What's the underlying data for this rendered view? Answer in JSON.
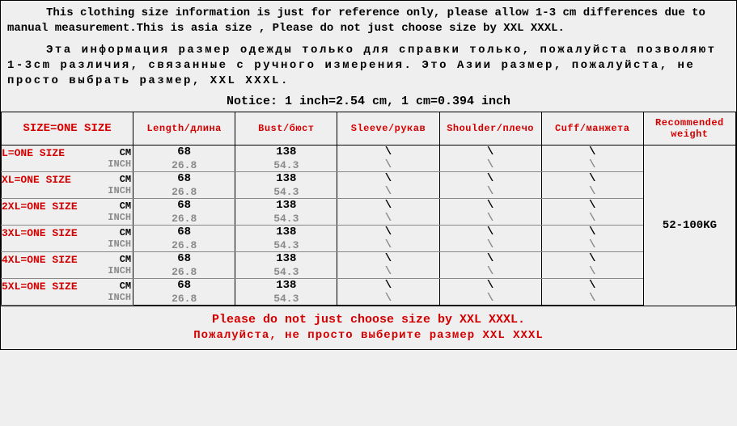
{
  "info_en": "This clothing size information is just for reference only, please allow 1-3 cm differences due to manual measurement.This is asia size , Please do not just choose size by XXL XXXL.",
  "info_ru": "Эта информация размер одежды только для справки только, пожалуйста позволяют 1-3cm различия, связанные с ручного измерения. Это Азии размер, пожалуйста, не просто выбрать размер, XXL XXXL.",
  "notice": "Notice: 1 inch=2.54 cm, 1 cm=0.394 inch",
  "headers": {
    "size": "SIZE=ONE SIZE",
    "length": "Length/длина",
    "bust": "Bust/бюст",
    "sleeve": "Sleeve/рукав",
    "shoulder": "Shoulder/плечо",
    "cuff": "Cuff/манжета",
    "weight": "Recommended weight"
  },
  "units": {
    "cm": "CM",
    "inch": "INCH"
  },
  "rows": [
    {
      "size": "L=ONE SIZE",
      "length_cm": "68",
      "length_in": "26.8",
      "bust_cm": "138",
      "bust_in": "54.3",
      "sleeve": "\\",
      "shoulder": "\\",
      "cuff": "\\"
    },
    {
      "size": "XL=ONE SIZE",
      "length_cm": "68",
      "length_in": "26.8",
      "bust_cm": "138",
      "bust_in": "54.3",
      "sleeve": "\\",
      "shoulder": "\\",
      "cuff": "\\"
    },
    {
      "size": "2XL=ONE SIZE",
      "length_cm": "68",
      "length_in": "26.8",
      "bust_cm": "138",
      "bust_in": "54.3",
      "sleeve": "\\",
      "shoulder": "\\",
      "cuff": "\\"
    },
    {
      "size": "3XL=ONE SIZE",
      "length_cm": "68",
      "length_in": "26.8",
      "bust_cm": "138",
      "bust_in": "54.3",
      "sleeve": "\\",
      "shoulder": "\\",
      "cuff": "\\"
    },
    {
      "size": "4XL=ONE SIZE",
      "length_cm": "68",
      "length_in": "26.8",
      "bust_cm": "138",
      "bust_in": "54.3",
      "sleeve": "\\",
      "shoulder": "\\",
      "cuff": "\\"
    },
    {
      "size": "5XL=ONE SIZE",
      "length_cm": "68",
      "length_in": "26.8",
      "bust_cm": "138",
      "bust_in": "54.3",
      "sleeve": "\\",
      "shoulder": "\\",
      "cuff": "\\"
    }
  ],
  "weight": "52-100KG",
  "footer_en": "Please do not just choose size by XXL XXXL.",
  "footer_ru": "Пожалуйста, не просто выберите размер XXL XXXL"
}
